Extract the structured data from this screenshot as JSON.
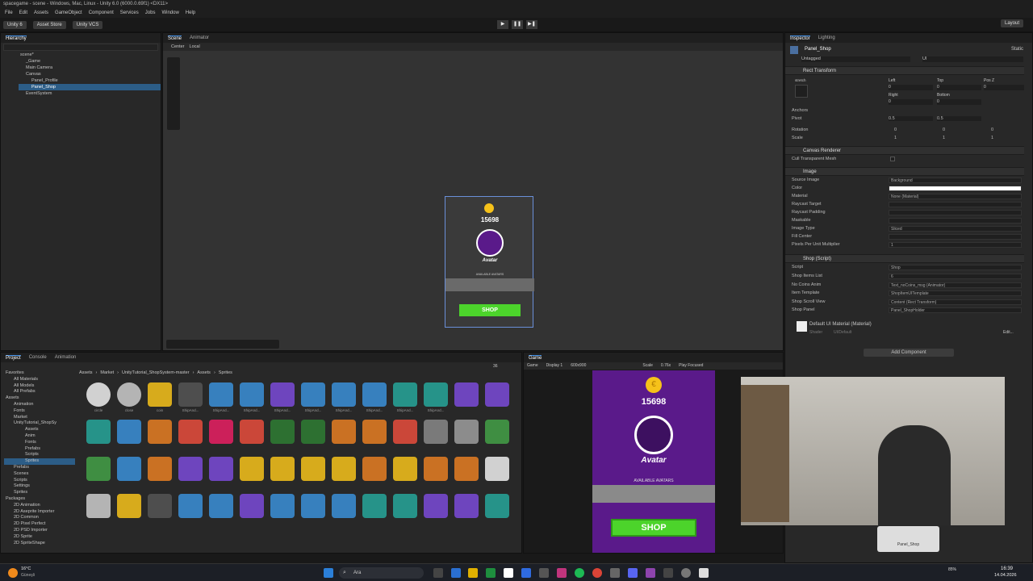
{
  "window": {
    "title": "spacegame - scene - Windows, Mac, Linux - Unity 6.0 (6000.0.69f1) <DX11>"
  },
  "menu": [
    "File",
    "Edit",
    "Assets",
    "GameObject",
    "Component",
    "Services",
    "Jobs",
    "Window",
    "Help"
  ],
  "toolbar": {
    "account": "Unity 6",
    "asset_store": "Asset Store",
    "vcs": "Unity VCS",
    "layout": "Layout"
  },
  "hierarchy": {
    "tab": "Hierarchy",
    "items": [
      {
        "label": "scene*",
        "indent": 0
      },
      {
        "label": "_Game",
        "indent": 1
      },
      {
        "label": "Main Camera",
        "indent": 1
      },
      {
        "label": "Canvas",
        "indent": 1
      },
      {
        "label": "Panel_Profile",
        "indent": 2
      },
      {
        "label": "Panel_Shop",
        "indent": 2
      },
      {
        "label": "EventSystem",
        "indent": 1
      }
    ]
  },
  "scene": {
    "tab_scene": "Scene",
    "tab_animator": "Animator",
    "pivot": "Center",
    "space": "Local",
    "coins": "15698",
    "avatar_label": "Avatar",
    "available": "AVAILABLE AVATARS",
    "shop": "SHOP"
  },
  "inspector": {
    "tab": "Inspector",
    "tab2": "Lighting",
    "object_name": "Panel_Shop",
    "static": "Static",
    "tag": "Untagged",
    "layer": "UI",
    "stretch": "stretch",
    "rect_transform": "Rect Transform",
    "rt_labels": {
      "left": "Left",
      "top": "Top",
      "posz": "Pos Z",
      "right": "Right",
      "bottom": "Bottom"
    },
    "rt_values": {
      "left": "0",
      "top": "0",
      "posz": "0",
      "right": "0",
      "bottom": "0"
    },
    "anchors": "Anchors",
    "pivot": "Pivot",
    "pivot_x": "0.5",
    "pivot_y": "0.5",
    "rotation": "Rotation",
    "rot": [
      "0",
      "0",
      "0"
    ],
    "scale": "Scale",
    "scl": [
      "1",
      "1",
      "1"
    ],
    "canvas_renderer": "Canvas Renderer",
    "cull": "Cull Transparent Mesh",
    "image": "Image",
    "image_rows": [
      [
        "Source Image",
        "Background"
      ],
      [
        "Color",
        ""
      ],
      [
        "Material",
        "None (Material)"
      ],
      [
        "Raycast Target",
        ""
      ],
      [
        "Raycast Padding",
        ""
      ],
      [
        "Maskable",
        ""
      ],
      [
        "Image Type",
        "Sliced"
      ],
      [
        "Fill Center",
        ""
      ],
      [
        "Pixels Per Unit Multiplier",
        "1"
      ]
    ],
    "shop_script": "Shop (Script)",
    "script_row": [
      "Script",
      "Shop"
    ],
    "shop_rows": [
      [
        "Shop Items List",
        "6"
      ],
      [
        "No Coins Anim",
        "Text_noCoins_msg (Animator)"
      ],
      [
        "Item Template",
        "ShopItemUITemplate"
      ],
      [
        "Shop Scroll View",
        "Content (Rect Transform)"
      ],
      [
        "Shop Panel",
        "Panel_ShopHolder"
      ]
    ],
    "material": "Default UI Material (Material)",
    "shader": "Shader",
    "shader_val": "UI/Default",
    "edit": "Edit...",
    "add_component": "Add Component"
  },
  "project": {
    "tab": "Project",
    "tab2": "Console",
    "tab3": "Animation",
    "breadcrumb": [
      "Assets",
      "Market",
      "UnityTutorial_ShopSystem-master",
      "Assets",
      "Sprites"
    ],
    "tree": [
      "Favorites",
      "All Materials",
      "All Models",
      "All Prefabs",
      "Assets",
      "Animation",
      "Fonts",
      "Market",
      "UnityTutorial_ShopSy",
      "Assets",
      "Anim",
      "Fonts",
      "Prefabs",
      "Scripts",
      "Sprites",
      "Prefabs",
      "Scenes",
      "Scripts",
      "Settings",
      "Sprites",
      "Packages",
      "2D Animation",
      "2D Aseprite Importer",
      "2D Common",
      "2D Pixel Perfect",
      "2D PSD Importer",
      "2D Sprite",
      "2D SpriteShape"
    ],
    "sprite_labels": [
      "circle",
      "close",
      "coin",
      "ShipAnd...",
      "ShipAnd...",
      "ShipAnd...",
      "ShipAnd...",
      "ShipAnd...",
      "ShipAnd...",
      "ShipAnd...",
      "ShipAnd...",
      "ShipAnd..."
    ],
    "count": "36"
  },
  "game": {
    "tab": "Game",
    "display_mode": "Game",
    "display": "Display 1",
    "resolution": "600x900",
    "scale": "Scale",
    "scale_val": "0.76x",
    "play": "Play Focused",
    "coins": "15698",
    "avatar_label": "Avatar",
    "available": "AVAILABLE AVATARS",
    "shop": "SHOP"
  },
  "webcam": {
    "caption": "Panel_Shop"
  },
  "taskbar": {
    "weather_temp": "16°C",
    "weather_desc": "Güneşli",
    "search": "Ara",
    "time": "16:39",
    "date": "14.04.2026",
    "battery": "85%"
  },
  "colors": {
    "accent": "#3d8ee8",
    "game_bg": "#5a1a8a",
    "shop_green": "#4cd42b",
    "coin": "#f6c21a"
  }
}
